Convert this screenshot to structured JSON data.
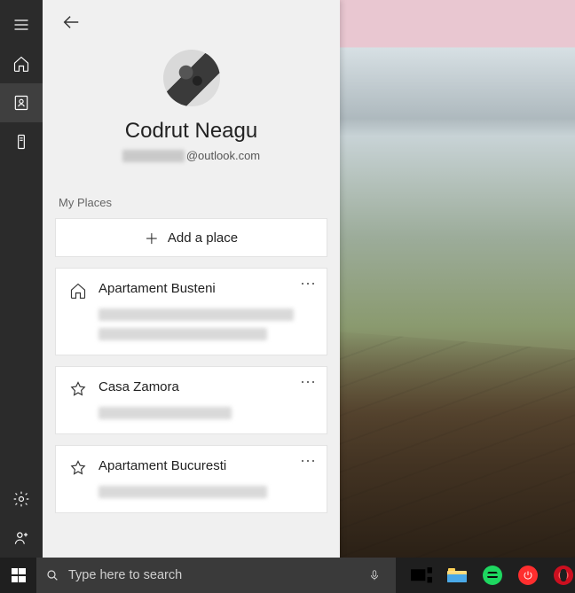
{
  "rail": {
    "items": [
      {
        "name": "menu",
        "selected": false
      },
      {
        "name": "home",
        "selected": false
      },
      {
        "name": "account",
        "selected": true
      },
      {
        "name": "device",
        "selected": false
      }
    ],
    "footer": [
      {
        "name": "settings"
      },
      {
        "name": "people"
      }
    ]
  },
  "profile": {
    "display_name": "Codrut Neagu",
    "email_suffix": "@outlook.com"
  },
  "sections": {
    "my_places_label": "My Places",
    "add_place_label": "Add a place"
  },
  "places": [
    {
      "icon": "home",
      "title": "Apartament Busteni",
      "redacted_lines": 2
    },
    {
      "icon": "star",
      "title": "Casa Zamora",
      "redacted_lines": 1
    },
    {
      "icon": "star",
      "title": "Apartament Bucuresti",
      "redacted_lines": 1
    }
  ],
  "taskbar": {
    "search_placeholder": "Type here to search",
    "pinned": [
      "task-view",
      "file-explorer",
      "spotify",
      "power",
      "opera"
    ]
  }
}
